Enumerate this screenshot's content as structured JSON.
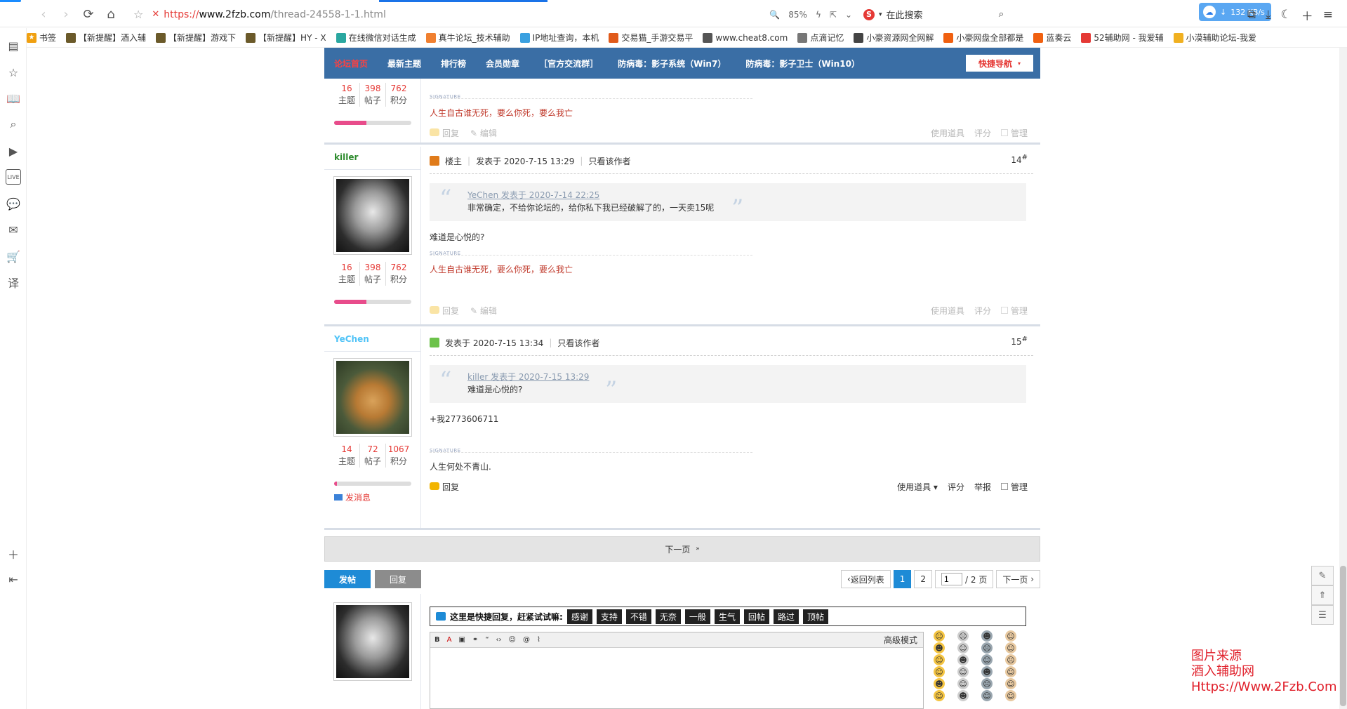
{
  "browser": {
    "url_protocol": "https://",
    "url_domain": "www.2fzb.com",
    "url_path": "/thread-24558-1-1.html",
    "zoom": "85%",
    "search_engine_letter": "S",
    "search_placeholder": "在此搜索",
    "download_speed": "132 KB/s"
  },
  "bookmarks": [
    {
      "label": "书签",
      "color": "#f0a010"
    },
    {
      "label": "【新提醒】酒入辅",
      "color": "#6b5a2a"
    },
    {
      "label": "【新提醒】游戏下",
      "color": "#6b5a2a"
    },
    {
      "label": "【新提醒】HY - X",
      "color": "#6b5a2a"
    },
    {
      "label": "在线微信对话生成",
      "color": "#2aa7a0"
    },
    {
      "label": "真牛论坛_技术辅助",
      "color": "#f08030"
    },
    {
      "label": "IP地址查询，本机",
      "color": "#3aa0e0"
    },
    {
      "label": "交易猫_手游交易平",
      "color": "#e05a1a"
    },
    {
      "label": "www.cheat8.com",
      "color": "#555"
    },
    {
      "label": "点滴记忆",
      "color": "#777"
    },
    {
      "label": "小豪资源网全网解",
      "color": "#444"
    },
    {
      "label": "小豪网盘全部都是",
      "color": "#f06010"
    },
    {
      "label": "蓝奏云",
      "color": "#f06010"
    },
    {
      "label": "52辅助网 - 我爱辅",
      "color": "#e53935"
    },
    {
      "label": "小漠辅助论坛-我爱",
      "color": "#f0b020"
    }
  ],
  "nav": {
    "items": [
      "论坛首页",
      "最新主题",
      "排行榜",
      "会员勋章",
      "［官方交流群］",
      "防病毒：影子系统（Win7）",
      "防病毒：影子卫士（Win10）"
    ],
    "quick_nav": "快捷导航"
  },
  "post13": {
    "stats": {
      "topics": "16",
      "posts": "398",
      "points": "762"
    },
    "stat_labels": {
      "topics": "主题",
      "posts": "帖子",
      "points": "积分"
    },
    "signature_label": "SIGNATURE",
    "signature": "人生自古谁无死，要么你死，要么我亡",
    "footer": {
      "reply": "回复",
      "edit": "编辑",
      "tools": "使用道具",
      "rate": "评分",
      "manage": "管理"
    }
  },
  "post14": {
    "username": "killer",
    "badge": "楼主",
    "posted": "发表于 2020-7-15 13:29",
    "author_only": "只看该作者",
    "floor": "14",
    "quote_author": "YeChen 发表于 2020-7-14 22:25",
    "quote_text": "非常确定，不给你论坛的，给你私下我已经破解了的，一天卖15呢",
    "body": "难道是心悦的?",
    "stats": {
      "topics": "16",
      "posts": "398",
      "points": "762"
    },
    "signature_label": "SIGNATURE",
    "signature": "人生自古谁无死，要么你死，要么我亡",
    "footer": {
      "reply": "回复",
      "edit": "编辑",
      "tools": "使用道具",
      "rate": "评分",
      "manage": "管理"
    }
  },
  "post15": {
    "username": "YeChen",
    "posted": "发表于 2020-7-15 13:34",
    "author_only": "只看该作者",
    "floor": "15",
    "quote_author": "killer 发表于 2020-7-15 13:29",
    "quote_text": "难道是心悦的?",
    "body": "+我2773606711",
    "stats": {
      "topics": "14",
      "posts": "72",
      "points": "1067"
    },
    "send_message": "发消息",
    "signature_label": "SIGNATURE",
    "signature": "人生何处不青山.",
    "footer": {
      "reply": "回复",
      "tools": "使用道具",
      "rate": "评分",
      "report": "举报",
      "manage": "管理"
    }
  },
  "pagination": {
    "next_page_bar": "下一页",
    "post_button": "发帖",
    "reply_button": "回复",
    "back_to_list": "返回列表",
    "current_page": "1",
    "page2": "2",
    "page_input": "1",
    "total_pages": "/ 2 页",
    "next": "下一页"
  },
  "quick_reply": {
    "prompt": "这里是快捷回复，赶紧试试嘛:",
    "tags": [
      "感谢",
      "支持",
      "不错",
      "无奈",
      "一般",
      "生气",
      "回帖",
      "路过",
      "顶帖"
    ],
    "advanced_mode": "高级模式"
  },
  "watermark": {
    "line1": "图片来源",
    "line2": "酒入辅助网",
    "line3": "Https://Www.2Fzb.Com"
  },
  "colors": {
    "nav_bg": "#3a6ea5",
    "accent_red": "#e53935",
    "primary_blue": "#1e8bd6"
  }
}
